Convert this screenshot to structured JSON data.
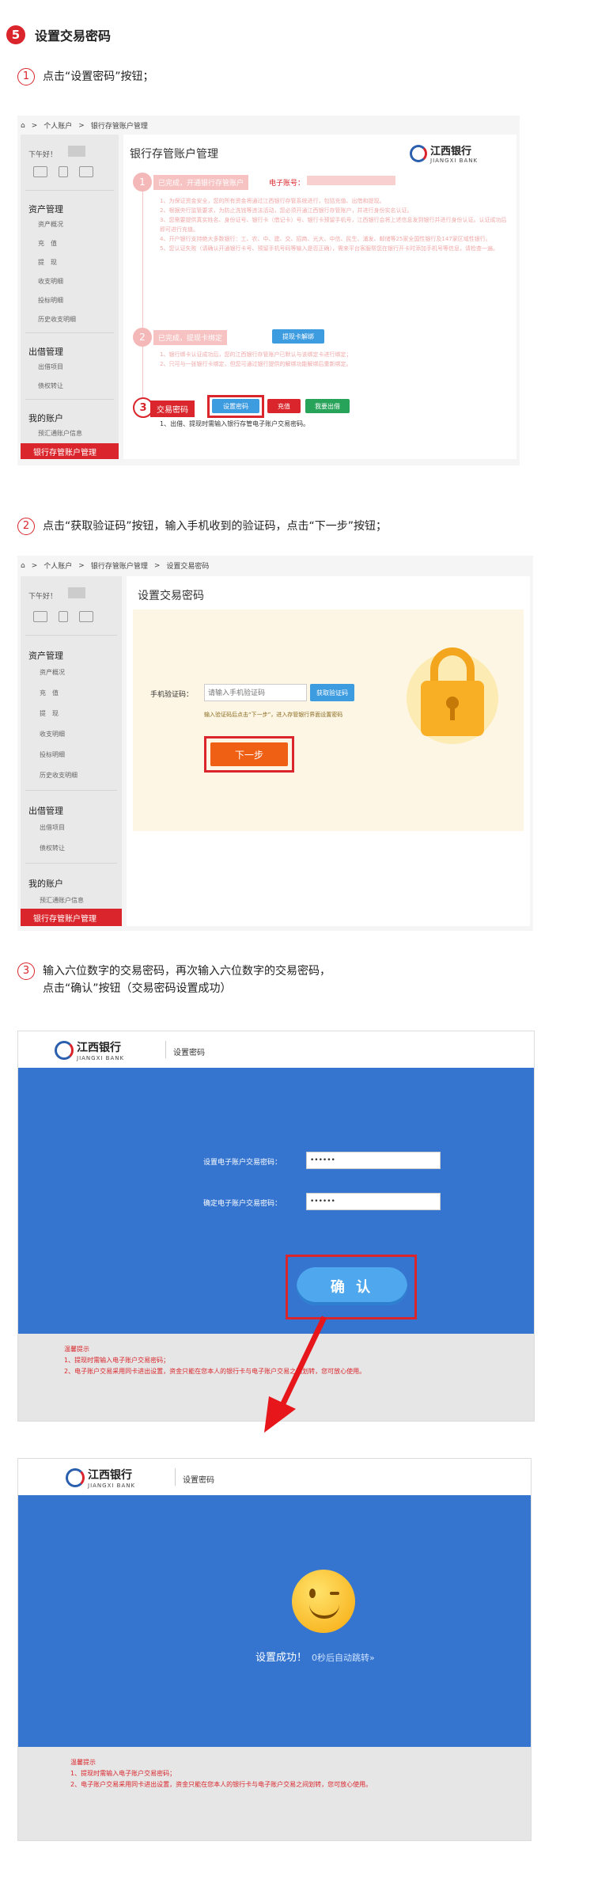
{
  "step": {
    "number": "5",
    "title": "设置交易密码"
  },
  "instructions": {
    "i1": {
      "num": "1",
      "text": "点击“设置密码”按钮；"
    },
    "i2": {
      "num": "2",
      "text": "点击“获取验证码”按钮，输入手机收到的验证码，点击“下一步”按钮；"
    },
    "i3": {
      "num": "3",
      "line1": "输入六位数字的交易密码，再次输入六位数字的交易密码，",
      "line2": "点击“确认”按钮（交易密码设置成功）"
    }
  },
  "shot1": {
    "breadcrumb": [
      "个人账户",
      "银行存管账户管理"
    ],
    "greeting": "下午好！",
    "title": "银行存管账户管理",
    "bank_cn": "江西银行",
    "bank_en": "JIANGXI BANK",
    "step1_label": "已完成，开通银行存管账户",
    "account_label": "电子账号：",
    "step1_text": [
      "1、为保证资金安全，您的所有资金将通过江西银行存管系统进行，包括充值、出借和提现。",
      "2、根据央行监管要求，为防止洗钱等违法活动，您必须开通江西银行存管账户，并进行身份实名认证。",
      "3、您需要提供真实姓名、身份证号、银行卡（借记卡）号、银行卡预留手机号，江西银行会将上述信息发到银行并进行身份认证。认证成功后即可进行充值。",
      "4、开户银行支持绝大多数银行：工、农、中、建、交、招商、光大、中信、民生、浦发、邮储等25家全国性银行及147家区域性银行。",
      "5、您认证失败（请确认开通银行卡号、预留手机号码等输入是否正确），需来平台客服帮您在银行开卡时添加手机号等信息，请检查一遍。"
    ],
    "step2_label": "已完成，提现卡绑定",
    "step2_btn": "提现卡解绑",
    "step2_text": [
      "1、银行绑卡认证成功后，您的江西银行存管账户已默认与该绑定卡进行绑定；",
      "2、只可与一张银行卡绑定，但您可通过银行提供的解绑功能解绑后重新绑定。"
    ],
    "step3_label": "交易密码",
    "btn_set": "设置密码",
    "btn_recharge": "充值",
    "btn_lend": "我要出借",
    "step3_note": "1、出借、提现时需输入银行存管电子账户交易密码。"
  },
  "sidebar": {
    "asset_head": "资产管理",
    "asset_items": [
      "资产概况",
      "充　值",
      "提　现",
      "收支明细",
      "投标明细",
      "历史收支明细"
    ],
    "lend_head": "出借管理",
    "lend_items": [
      "出借项目",
      "债权转让"
    ],
    "account_head": "我的账户",
    "account_items": [
      "预汇通账户信息"
    ],
    "active": "银行存管账户管理"
  },
  "shot2": {
    "breadcrumb": [
      "个人账户",
      "银行存管账户管理",
      "设置交易密码"
    ],
    "title": "设置交易密码",
    "phone_label": "手机验证码：",
    "phone_placeholder": "请输入手机验证码",
    "get_code": "获取验证码",
    "hint": "输入验证码后点击“下一步”，进入存管银行界面设置密码",
    "next": "下一步"
  },
  "shot3": {
    "bank_cn": "江西银行",
    "bank_en": "JIANGXI BANK",
    "header_title": "设置密码",
    "pwd1_label": "设置电子账户交易密码：",
    "pwd1_value": "••••••",
    "pwd2_label": "确定电子账户交易密码：",
    "pwd2_value": "••••••",
    "confirm": "确 认",
    "tips_title": "温馨提示",
    "tip1": "1、提现时需输入电子账户交易密码；",
    "tip2": "2、电子账户交易采用同卡进出设置，资金只能在您本人的银行卡与电子账户交易之间划转，您可放心使用。"
  },
  "shot4": {
    "header_title": "设置密码",
    "success": "设置成功！",
    "redirect": "0秒后自动跳转»",
    "tips_title": "温馨提示",
    "tip1": "1、提现时需输入电子账户交易密码；",
    "tip2": "2、电子账户交易采用同卡进出设置，资金只能在您本人的银行卡与电子账户交易之间划转，您可放心使用。"
  },
  "colors": {
    "accent": "#d9252b",
    "blue": "#3575d0",
    "button_blue": "#3d9be0",
    "orange": "#f06014",
    "green": "#27a35a"
  }
}
